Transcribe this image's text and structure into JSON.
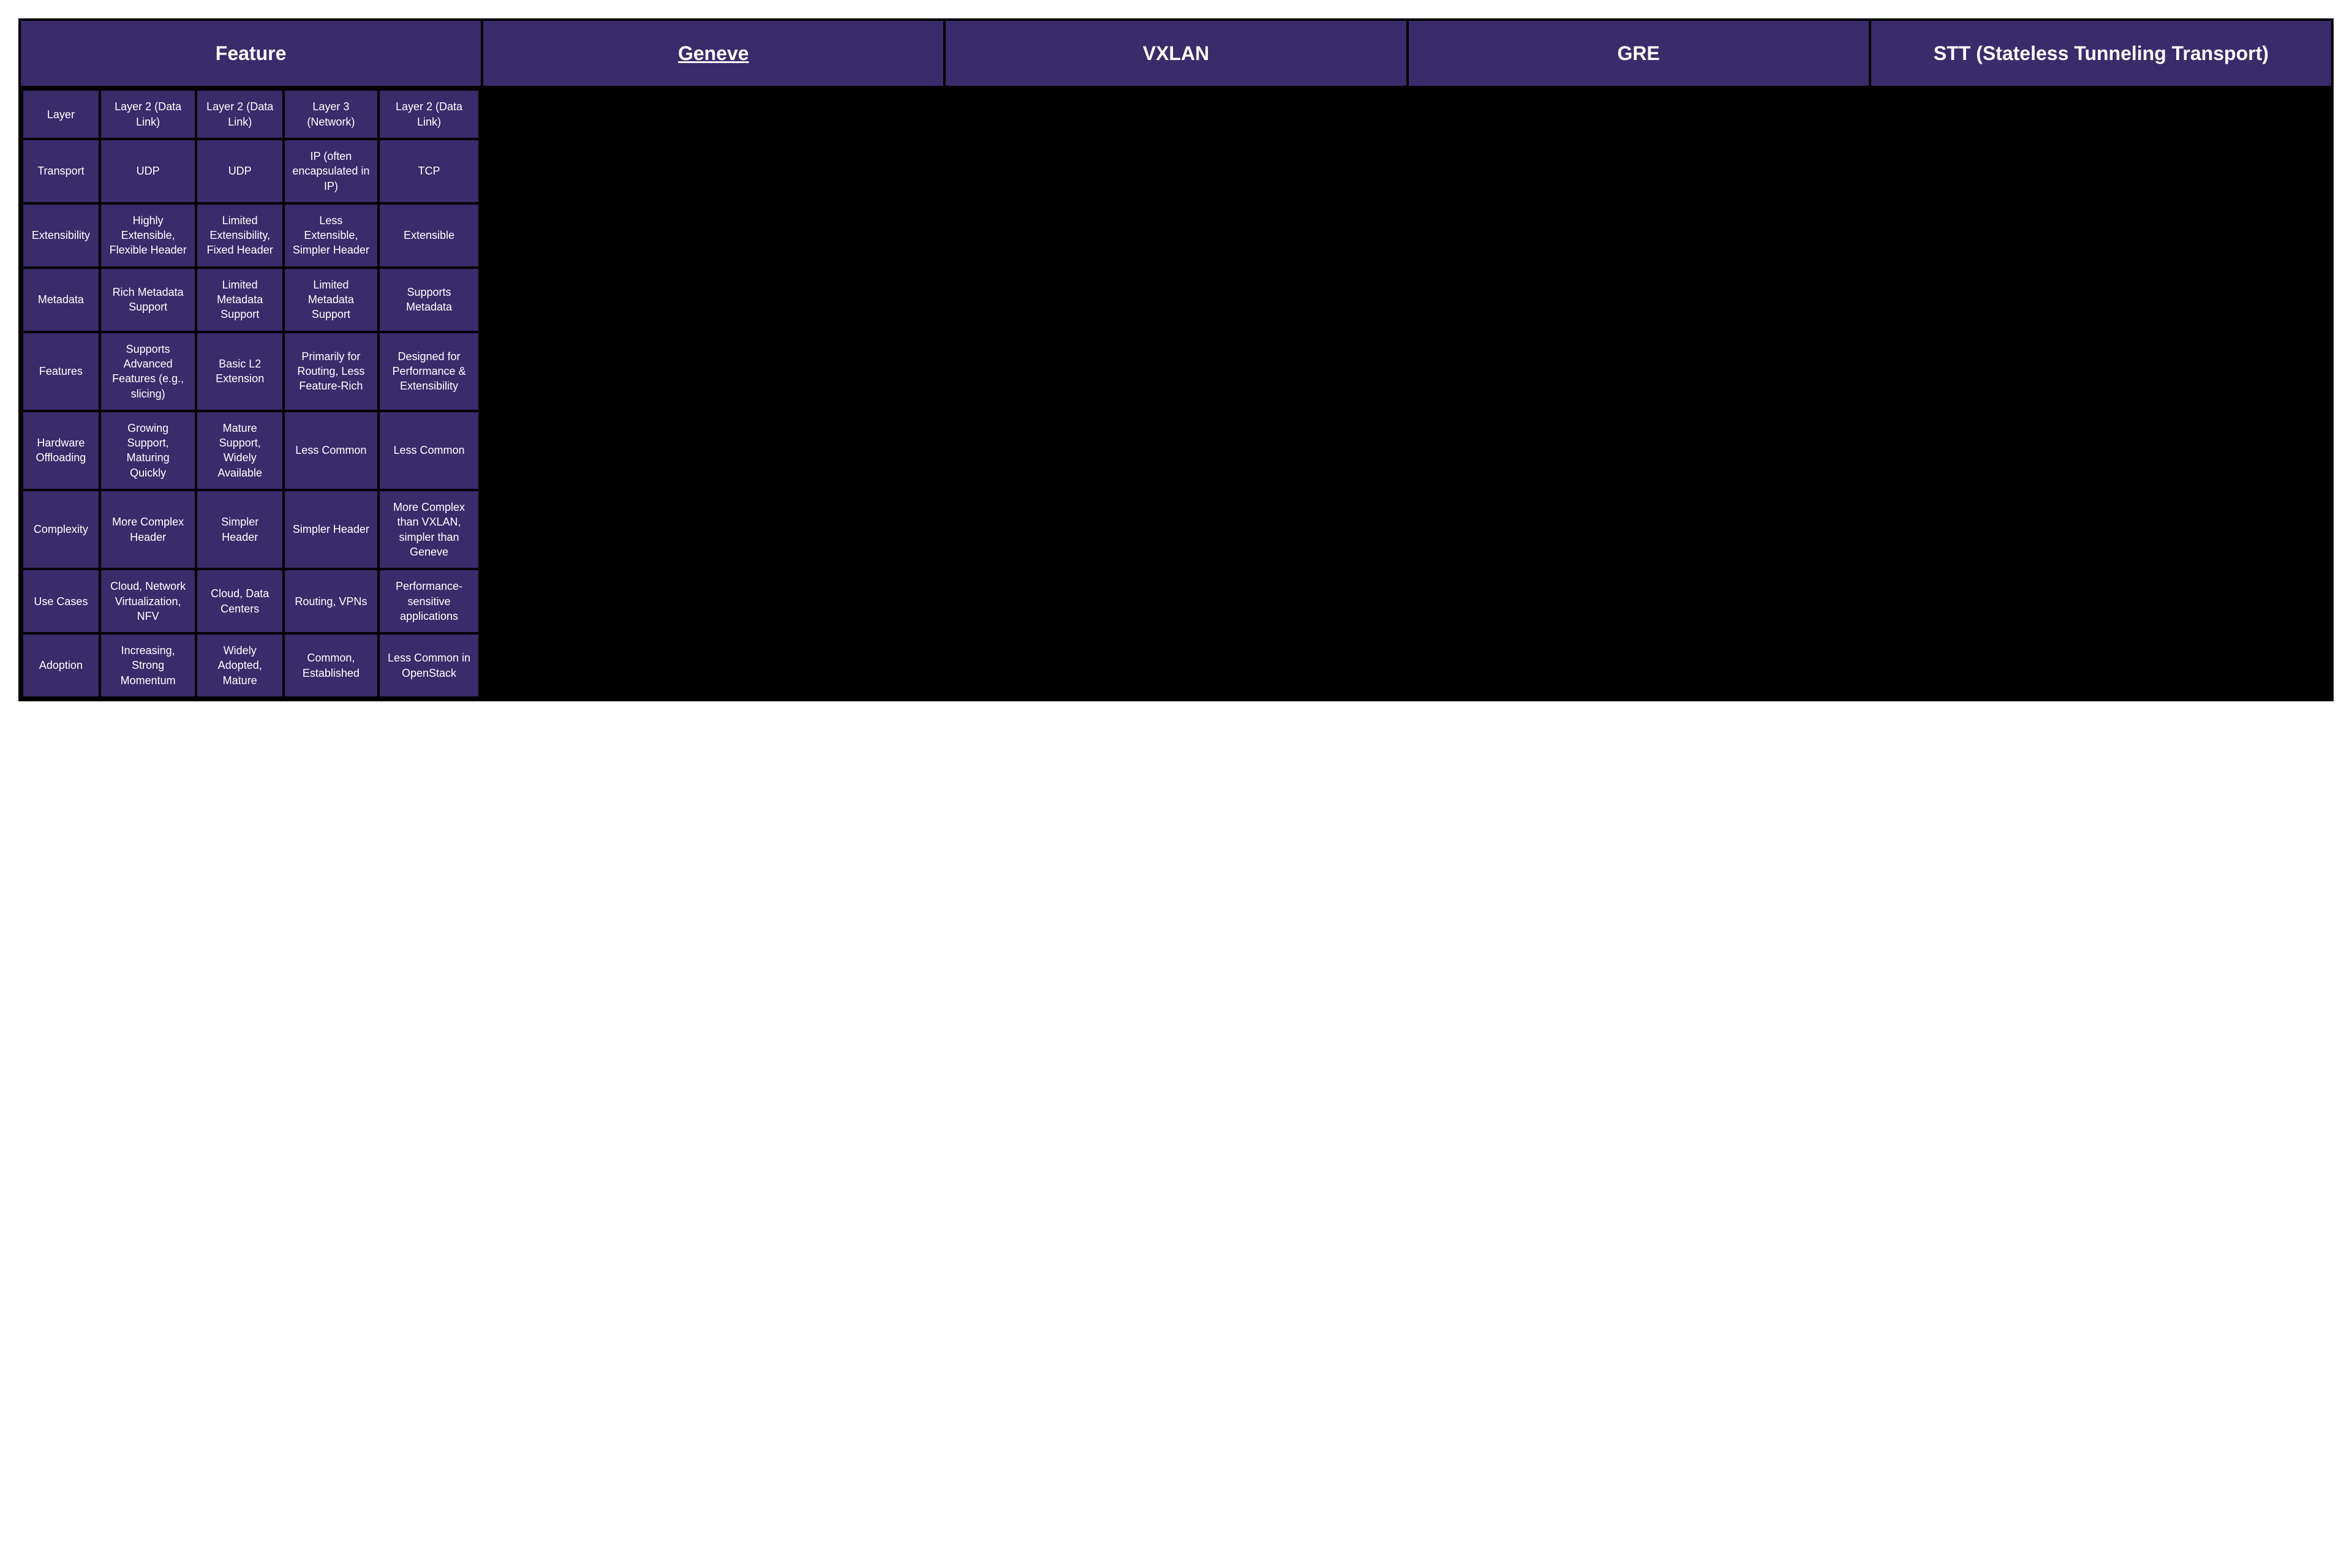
{
  "chart_data": {
    "type": "table",
    "columns": [
      "Feature",
      "Geneve",
      "VXLAN",
      "GRE",
      "STT (Stateless Tunneling Transport)"
    ],
    "rows": [
      [
        "Layer",
        "Layer 2 (Data Link)",
        "Layer 2 (Data Link)",
        "Layer 3 (Network)",
        "Layer 2 (Data Link)"
      ],
      [
        "Transport",
        "UDP",
        "UDP",
        "IP (often encapsulated in IP)",
        "TCP"
      ],
      [
        "Extensibility",
        "Highly Extensible, Flexible Header",
        "Limited Extensibility, Fixed Header",
        "Less Extensible, Simpler Header",
        "Extensible"
      ],
      [
        "Metadata",
        "Rich Metadata Support",
        "Limited Metadata Support",
        "Limited Metadata Support",
        "Supports Metadata"
      ],
      [
        "Features",
        "Supports Advanced Features (e.g., slicing)",
        "Basic L2 Extension",
        "Primarily for Routing, Less Feature-Rich",
        "Designed for Performance & Extensibility"
      ],
      [
        "Hardware Offloading",
        "Growing Support, Maturing Quickly",
        "Mature Support, Widely Available",
        "Less Common",
        "Less Common"
      ],
      [
        "Complexity",
        "More Complex Header",
        "Simpler Header",
        "Simpler Header",
        "More Complex than VXLAN, simpler than Geneve"
      ],
      [
        "Use Cases",
        "Cloud, Network Virtualization, NFV",
        "Cloud, Data Centers",
        "Routing, VPNs",
        "Performance-sensitive applications"
      ],
      [
        "Adoption",
        "Increasing, Strong Momentum",
        "Widely Adopted, Mature",
        "Common, Established",
        "Less Common in OpenStack"
      ]
    ]
  }
}
